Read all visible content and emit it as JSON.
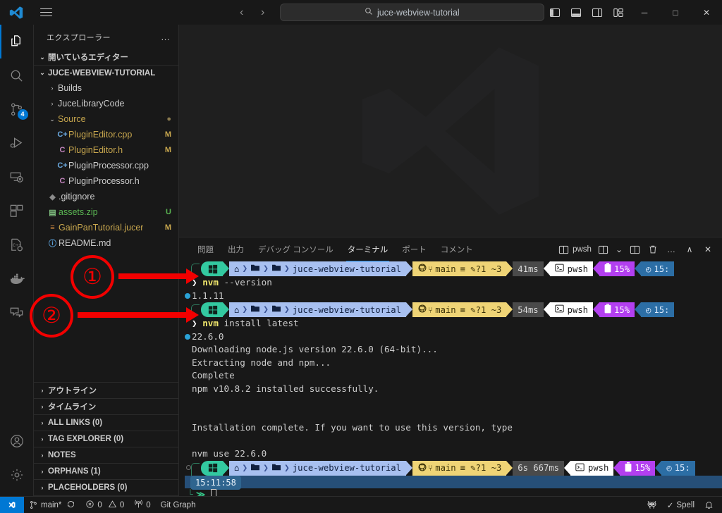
{
  "titlebar": {
    "logo": "vscode-logo",
    "menu": "hamburger-menu",
    "back": "‹",
    "forward": "›",
    "search_icon": "search-icon",
    "search_value": "juce-webview-tutorial",
    "layout_icons": [
      "toggle-primary-sidebar",
      "toggle-panel",
      "toggle-secondary-sidebar",
      "customize-layout"
    ],
    "minimize": "─",
    "maximize": "□",
    "close": "✕"
  },
  "activitybar": {
    "items": [
      {
        "name": "explorer",
        "icon": "files-icon",
        "active": true,
        "badge": ""
      },
      {
        "name": "search",
        "icon": "search-icon",
        "active": false,
        "badge": ""
      },
      {
        "name": "source-control",
        "icon": "source-control-icon",
        "active": false,
        "badge": "4"
      },
      {
        "name": "run-and-debug",
        "icon": "run-debug-icon",
        "active": false,
        "badge": ""
      },
      {
        "name": "remote-explorer",
        "icon": "remote-explorer-icon",
        "active": false,
        "badge": ""
      },
      {
        "name": "extensions",
        "icon": "extensions-icon",
        "active": false,
        "badge": ""
      },
      {
        "name": "cmake-tools",
        "icon": "cpp-gear-icon",
        "active": false,
        "badge": ""
      },
      {
        "name": "docker",
        "icon": "docker-whale-icon",
        "active": false,
        "badge": ""
      },
      {
        "name": "chat",
        "icon": "chat-icon",
        "active": false,
        "badge": ""
      }
    ],
    "bottom": [
      {
        "name": "accounts",
        "icon": "account-icon"
      },
      {
        "name": "manage",
        "icon": "gear-icon"
      }
    ]
  },
  "sidebar": {
    "title": "エクスプローラー",
    "more_actions": "…",
    "open_editors": {
      "label": "開いているエディター",
      "expanded": true
    },
    "workspace": {
      "label": "JUCE-WEBVIEW-TUTORIAL",
      "expanded": true
    },
    "tree": [
      {
        "label": "Builds",
        "indent": 1,
        "type": "folder",
        "expanded": false,
        "icon": "",
        "badge": "",
        "badge_color": ""
      },
      {
        "label": "JuceLibraryCode",
        "indent": 1,
        "type": "folder",
        "expanded": false,
        "icon": "",
        "badge": "",
        "badge_color": ""
      },
      {
        "label": "Source",
        "indent": 1,
        "type": "folder",
        "expanded": true,
        "icon": "",
        "badge": "●",
        "badge_color": "#8a7a4e"
      },
      {
        "label": "PluginEditor.cpp",
        "indent": 2,
        "type": "file",
        "icon": "C+",
        "icon_color": "#6aa9e0",
        "badge": "M",
        "badge_color": "#c8a74e"
      },
      {
        "label": "PluginEditor.h",
        "indent": 2,
        "type": "file",
        "icon": "C",
        "icon_color": "#c586c0",
        "badge": "M",
        "badge_color": "#c8a74e"
      },
      {
        "label": "PluginProcessor.cpp",
        "indent": 2,
        "type": "file",
        "icon": "C+",
        "icon_color": "#6aa9e0",
        "badge": "",
        "badge_color": ""
      },
      {
        "label": "PluginProcessor.h",
        "indent": 2,
        "type": "file",
        "icon": "C",
        "icon_color": "#c586c0",
        "badge": "",
        "badge_color": ""
      },
      {
        "label": ".gitignore",
        "indent": 1,
        "type": "file",
        "icon": "◆",
        "icon_color": "#8c8c8c",
        "badge": "",
        "badge_color": ""
      },
      {
        "label": "assets.zip",
        "indent": 1,
        "type": "file",
        "icon": "▤",
        "icon_color": "#7fbf7f",
        "badge": "U",
        "badge_color": "#5ab552"
      },
      {
        "label": "GainPanTutorial.jucer",
        "indent": 1,
        "type": "file",
        "icon": "≡",
        "icon_color": "#d08a40",
        "badge": "M",
        "badge_color": "#c8a74e"
      },
      {
        "label": "README.md",
        "indent": 1,
        "type": "file",
        "icon": "ⓘ",
        "icon_color": "#5b9fd6",
        "badge": "",
        "badge_color": ""
      }
    ],
    "bottom_sections": [
      {
        "label": "アウトライン"
      },
      {
        "label": "タイムライン"
      },
      {
        "label": "ALL LINKS (0)"
      },
      {
        "label": "TAG EXPLORER (0)"
      },
      {
        "label": "NOTES"
      },
      {
        "label": "ORPHANS (1)"
      },
      {
        "label": "PLACEHOLDERS (0)"
      }
    ]
  },
  "panel": {
    "tabs": [
      {
        "label": "問題",
        "active": false
      },
      {
        "label": "出力",
        "active": false
      },
      {
        "label": "デバッグ コンソール",
        "active": false
      },
      {
        "label": "ターミナル",
        "active": true
      },
      {
        "label": "ポート",
        "active": false
      },
      {
        "label": "コメント",
        "active": false
      }
    ],
    "actions": {
      "new_terminal_label": "pwsh",
      "split_icon": "split-terminal-icon",
      "dropdown_icon": "chevron-down-icon",
      "layout_icon": "terminal-layout-icon",
      "kill_icon": "trash-icon",
      "more_icon": "…",
      "maximize_icon": "∧",
      "close_icon": "✕"
    }
  },
  "terminal": {
    "prompt": {
      "os_icon": "windows-icon",
      "home_icon": "⌂",
      "folder_icon": "folder-icon",
      "path": "juce-webview-tutorial",
      "git_icon": "github-icon",
      "branch_icon": "branch-icon",
      "branch": "main",
      "git_status": "≡ ✎?1 ~3",
      "shell": "pwsh",
      "battery": "15%",
      "battery_icon": "battery-icon",
      "clock_icon": "clock-icon",
      "time_short": "15:"
    },
    "blocks": [
      {
        "duration": "41ms",
        "command_prefix": "nvm",
        "command_args": "--version",
        "output": [
          "1.1.11"
        ]
      },
      {
        "duration": "54ms",
        "command_prefix": "nvm",
        "command_args": "install latest",
        "output": [
          "22.6.0",
          "Downloading node.js version 22.6.0 (64-bit)...",
          "Extracting node and npm...",
          "Complete",
          "npm v10.8.2 installed successfully.",
          "",
          "",
          "Installation complete. If you want to use this version, type",
          "",
          "nvm use 22.6.0"
        ]
      }
    ],
    "final_prompt": {
      "duration": "6s 667ms",
      "timestamp": "15:11:58",
      "prompt_glyph": "≫"
    }
  },
  "statusbar": {
    "remote_icon": "remote-window-icon",
    "branch": "main*",
    "sync_icon": "sync-icon",
    "errors_icon": "error-icon",
    "errors": "0",
    "warnings_icon": "warning-icon",
    "warnings": "0",
    "radio_icon": "radio-tower-icon",
    "ports": "0",
    "git_graph": "Git Graph",
    "right_icons": [
      "owl-icon"
    ],
    "spell": "Spell",
    "spell_check_icon": "✓",
    "bell_icon": "bell-icon"
  },
  "annotations": [
    {
      "number": "①",
      "target": "nvm --version command line"
    },
    {
      "number": "②",
      "target": "nvm install latest command line"
    }
  ],
  "colors": {
    "accent": "#0078d4",
    "annotation_red": "#f20000",
    "terminal_green": "#33c9a0",
    "terminal_path": "#a8c0f0",
    "terminal_git": "#efd476"
  }
}
